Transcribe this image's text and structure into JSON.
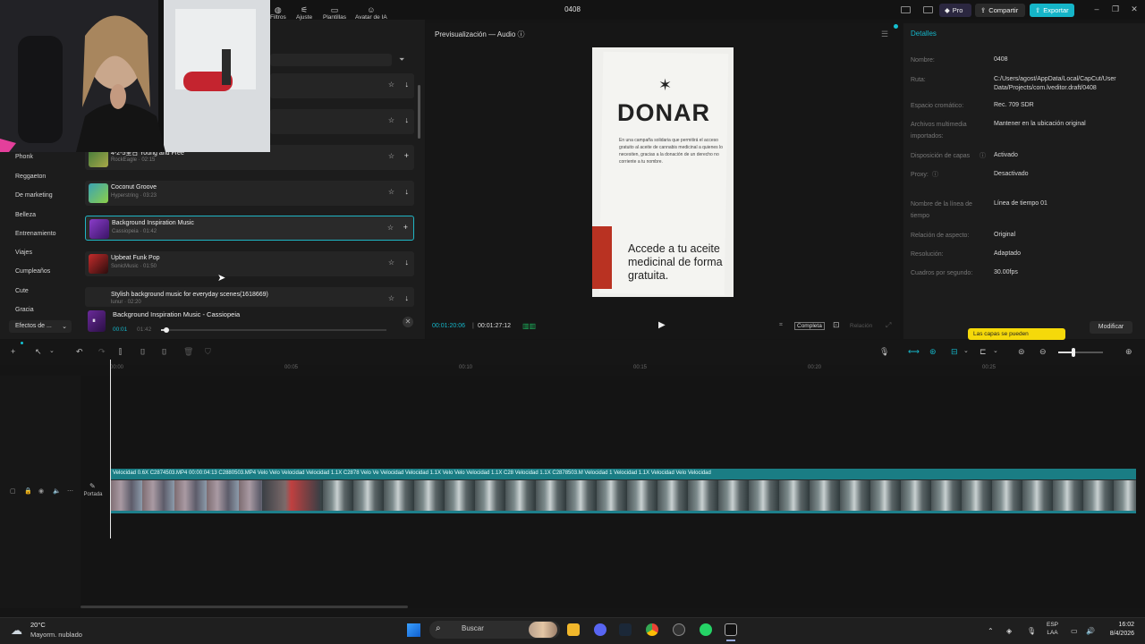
{
  "app": {
    "title": "0408",
    "pro_label": "Pro",
    "share_label": "Compartir",
    "export_label": "Exportar"
  },
  "toolbar": {
    "filters": "Filtros",
    "adjust": "Ajuste",
    "templates": "Plantillas",
    "ai_avatar": "Avatar de IA"
  },
  "categories": [
    "Phonk",
    "Reggaeton",
    "De marketing",
    "Belleza",
    "Entrenamiento",
    "Viajes",
    "Cumpleaños",
    "Cute",
    "Gracia"
  ],
  "category_more": "Efectos de ...",
  "tracks": [
    {
      "title": "4-2-5全日 Young and Free",
      "sub": "RockEagle · 02:15",
      "action": "+"
    },
    {
      "title": "Coconut Groove",
      "sub": "Hyperstring · 03:23",
      "action": "↓"
    },
    {
      "title": "Background Inspiration Music",
      "sub": "Cassiopeia · 01:42",
      "action": "+"
    },
    {
      "title": "Upbeat Funk Pop",
      "sub": "SonicMusic · 01:50",
      "action": "↓"
    },
    {
      "title": "Stylish background music for everyday scenes(1618669)",
      "sub": "lunur · 02:20",
      "action": "↓"
    }
  ],
  "player": {
    "title": "Background Inspiration Music - Cassiopeia",
    "time": "00:01",
    "total": "01:42",
    "progress": 0.02
  },
  "preview": {
    "title": "Previsualización — Audio",
    "current": "00:01:20:06",
    "total": "00:01:27:12",
    "full": "Completa",
    "ratio": "Relación",
    "poster_heading": "DONAR",
    "poster_body": "En una campaña solidaria que permitirá el acceso gratuito al aceite de cannabis medicinal a quienes lo necesiten, gracias a la donación de un derecho no corriente a tu nombre.",
    "poster_cta": "Accede a tu aceite medicinal de forma gratuita."
  },
  "details": {
    "title": "Detalles",
    "rows": [
      {
        "label": "Nombre:",
        "value": "0408"
      },
      {
        "label": "Ruta:",
        "value": "C:/Users/agost/AppData/Local/CapCut/User Data/Projects/com.lveditor.draft/0408"
      },
      {
        "label": "Espacio cromático:",
        "value": "Rec. 709 SDR"
      },
      {
        "label": "Archivos multimedia importados:",
        "value": "Mantener en la ubicación original"
      },
      {
        "label": "Disposición de capas",
        "value": "Activado"
      },
      {
        "label": "Proxy:",
        "value": "Desactivado"
      },
      {
        "label": "Nombre de la línea de tiempo",
        "value": "Línea de tiempo 01"
      },
      {
        "label": "Relación de aspecto:",
        "value": "Original"
      },
      {
        "label": "Resolución:",
        "value": "Adaptado"
      },
      {
        "label": "Cuadros por segundo:",
        "value": "30.00fps"
      }
    ],
    "modify": "Modificar",
    "tooltip": "Las capas se pueden"
  },
  "timeline": {
    "ruler": [
      "00:00",
      "00:05",
      "00:10",
      "00:15",
      "00:20",
      "00:25"
    ],
    "cover_label": "Portada",
    "clip_labels": "Velocidad 0.6X  C2874503.MP4  00:00:04:13    C2880503.MP4    Velo  Velo  Velocidad  Velocidad 1.1X  C2878  Velo  Ve  Velocidad  Velocidad 1.1X  Velo  Velo  Velocidad 1.1X  C28  Velocidad 1.1X  C2878503.M  Velocidad 1  Velocidad 1.1X  Velocidad  Velo  Velocidad"
  },
  "taskbar": {
    "temp": "20°C",
    "weather": "Mayorm. nublado",
    "search": "Buscar",
    "lang": "ESP",
    "region": "LAA",
    "time": "16:02",
    "date": "8/4/2026"
  }
}
